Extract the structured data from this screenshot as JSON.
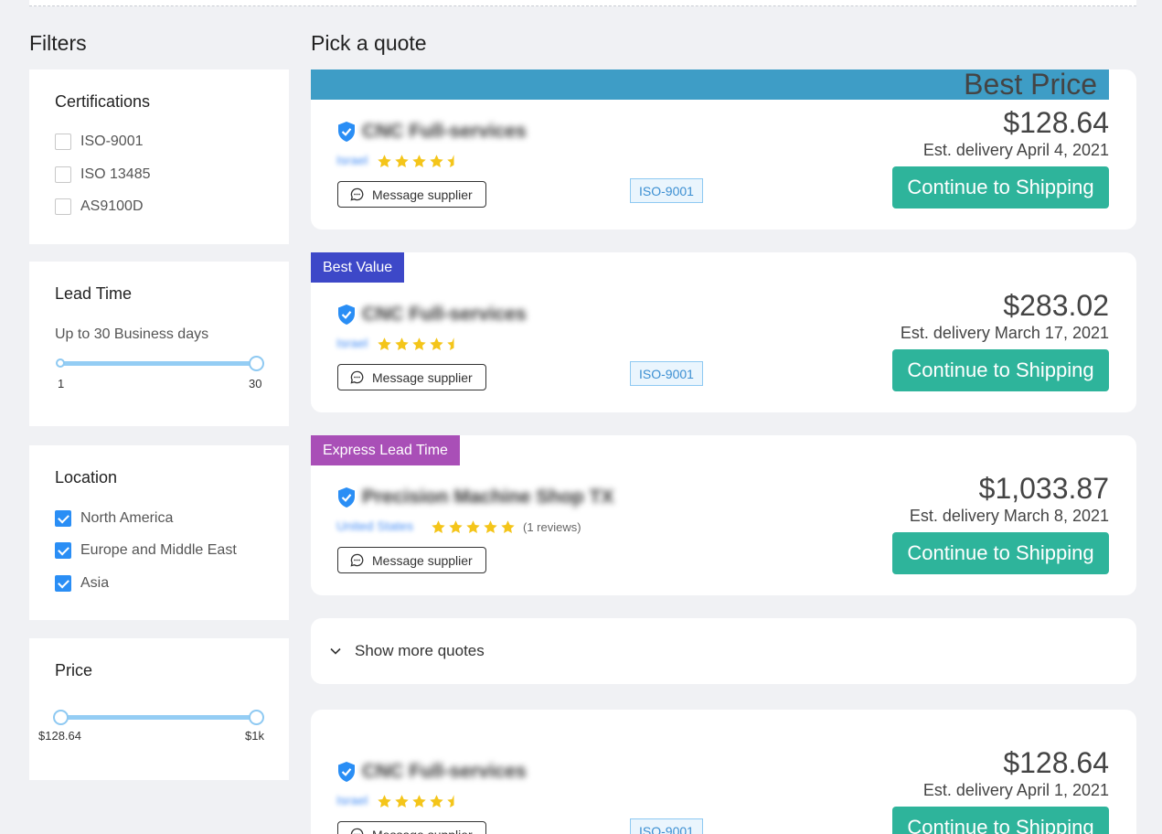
{
  "filters": {
    "title": "Filters",
    "certifications": {
      "heading": "Certifications",
      "options": [
        {
          "label": "ISO-9001",
          "checked": false
        },
        {
          "label": "ISO 13485",
          "checked": false
        },
        {
          "label": "AS9100D",
          "checked": false
        }
      ]
    },
    "lead_time": {
      "heading": "Lead Time",
      "summary": "Up to 30 Business days",
      "min_label": "1",
      "max_label": "30",
      "range_min": 1,
      "range_max": 30,
      "value_low": 1,
      "value_high": 30
    },
    "location": {
      "heading": "Location",
      "options": [
        {
          "label": "North America",
          "checked": true
        },
        {
          "label": "Europe and Middle East",
          "checked": true
        },
        {
          "label": "Asia",
          "checked": true
        }
      ]
    },
    "price": {
      "heading": "Price",
      "min_label": "$128.64",
      "max_label": "$1k",
      "value_low": 0,
      "value_high": 1
    }
  },
  "quotes": {
    "title": "Pick a quote",
    "message_label": "Message supplier",
    "ship_label": "Continue to Shipping",
    "items": [
      {
        "ribbon": "Best Price",
        "supplier": "CNC Full-services",
        "location": "Israel",
        "rating": 4.5,
        "reviews": "",
        "cert": "ISO-9001",
        "price": "$128.64",
        "delivery": "Est. delivery April 4, 2021"
      },
      {
        "ribbon": "Best Value",
        "supplier": "CNC Full-services",
        "location": "Israel",
        "rating": 4.5,
        "reviews": "",
        "cert": "ISO-9001",
        "price": "$283.02",
        "delivery": "Est. delivery March 17, 2021"
      },
      {
        "ribbon": "Express Lead Time",
        "supplier": "Precision Machine Shop TX",
        "location": "United States",
        "rating": 5,
        "reviews": "(1 reviews)",
        "cert": "",
        "price": "$1,033.87",
        "delivery": "Est. delivery March 8, 2021"
      },
      {
        "ribbon": "",
        "supplier": "CNC Full-services",
        "location": "Israel",
        "rating": 4.5,
        "reviews": "",
        "cert": "ISO-9001",
        "price": "$128.64",
        "delivery": "Est. delivery April 1, 2021"
      }
    ],
    "show_more": "Show more quotes"
  },
  "colors": {
    "best_price": "#3e9dc6",
    "best_value": "#3d48c8",
    "express": "#a94fb7",
    "cta": "#2eb49b",
    "checkbox": "#2a8ef5",
    "star": "#f4c51a"
  },
  "icons": {
    "verified": "shield-check-icon",
    "message": "chat-bubble-icon",
    "rating": "star-icon",
    "expand": "chevron-down-icon"
  }
}
